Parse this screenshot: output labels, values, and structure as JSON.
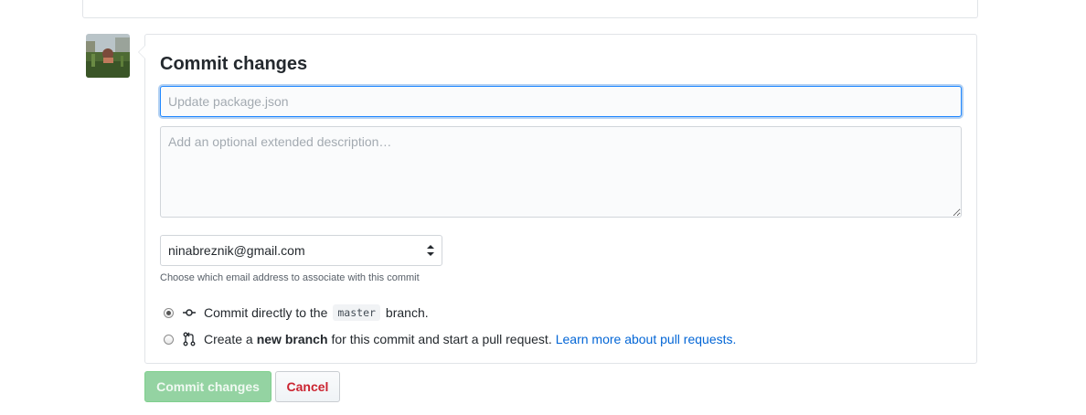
{
  "commit_form": {
    "title": "Commit changes",
    "summary_placeholder": "Update package.json",
    "summary_value": "",
    "description_placeholder": "Add an optional extended description…",
    "description_value": "",
    "email": {
      "selected": "ninabreznik@gmail.com",
      "hint": "Choose which email address to associate with this commit"
    },
    "options": {
      "direct": {
        "checked": true,
        "text_before": "Commit directly to the",
        "branch": "master",
        "text_after": "branch.",
        "icon": "git-commit-icon"
      },
      "new_branch": {
        "checked": false,
        "text_before": "Create a",
        "bold": "new branch",
        "text_after": "for this commit and start a pull request.",
        "link": "Learn more about pull requests.",
        "icon": "git-pull-request-icon"
      }
    },
    "buttons": {
      "commit": "Commit changes",
      "cancel": "Cancel"
    }
  },
  "colors": {
    "focus_border": "#2188ff",
    "link": "#0366d6",
    "commit_button_disabled": "#94d3a2",
    "cancel_text": "#cb2431"
  }
}
